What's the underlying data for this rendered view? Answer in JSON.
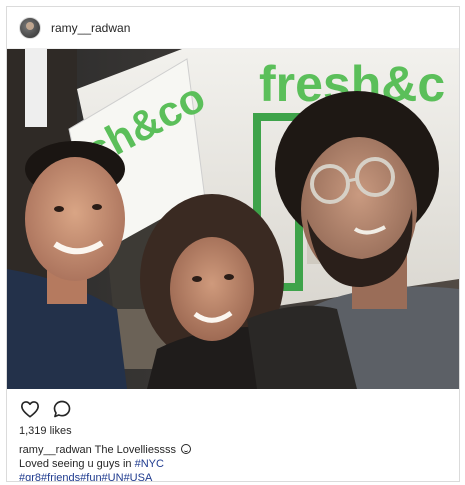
{
  "post": {
    "username": "ramy__radwan",
    "likes": "1,319 likes",
    "caption": {
      "author": "ramy__radwan",
      "text": "The Lovelliessss",
      "line2_prefix": "Loved seeing u guys in ",
      "line2_tag": "#NYC",
      "line3": "#gr8#friends#fun#UN#USA"
    },
    "photo": {
      "sign_text_left": "sh&co",
      "sign_text_right": "fresh&c"
    }
  },
  "icons": {
    "like": "heart-icon",
    "comment": "comment-icon",
    "emoji": "smile-emoji-icon"
  },
  "colors": {
    "tag": "#1f3b8f",
    "sign_green": "#5bbf5a"
  }
}
